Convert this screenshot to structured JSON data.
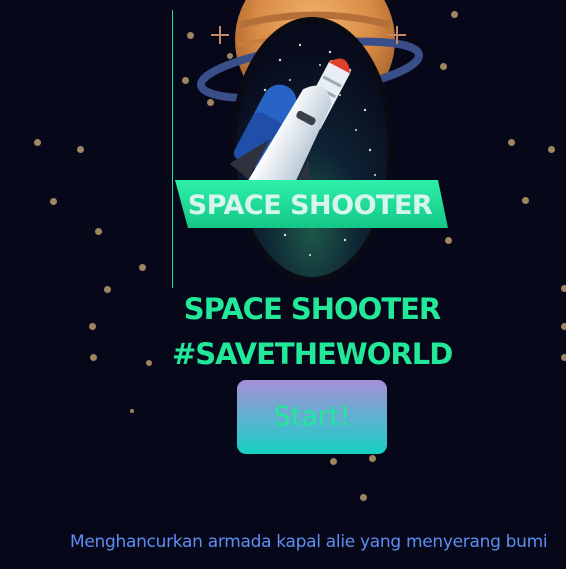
{
  "logo": {
    "banner_text": "SPACE SHOOTER",
    "icon": "space-shuttle-icon",
    "planet": "saturn-planet-icon"
  },
  "title": {
    "line1": "SPACE SHOOTER",
    "line2": "#SAVETHEWORLD"
  },
  "start_button": {
    "label": "Start!"
  },
  "description": "Menghancurkan armada kapal alie yang menyerang bumi",
  "colors": {
    "background": "#07071a",
    "accent_green": "#22e89a",
    "description_blue": "#5e8ef0",
    "star": "#a08660",
    "button_gradient_top": "#a78fd8",
    "button_gradient_bottom": "#14d0c2"
  }
}
